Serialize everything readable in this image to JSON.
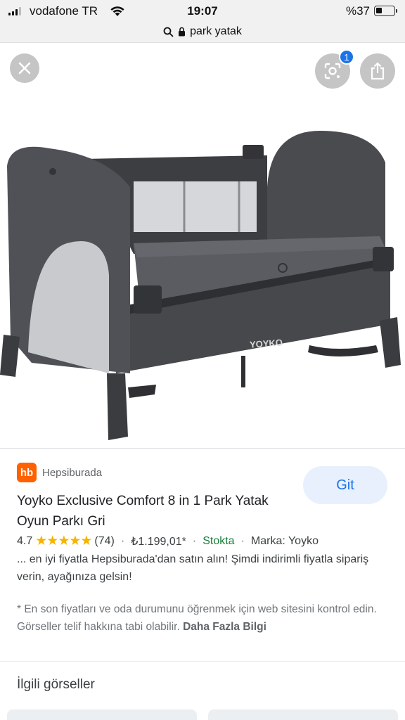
{
  "status_bar": {
    "carrier": "vodafone TR",
    "time": "19:07",
    "battery_pct": "%37"
  },
  "browser": {
    "url": "park yatak"
  },
  "viewer": {
    "close_icon": "close-icon",
    "lens_icon": "lens-icon",
    "lens_badge": "1",
    "share_icon": "share-icon",
    "product_image_text": "YOYKO"
  },
  "result": {
    "source_logo": "hb",
    "source_name": "Hepsiburada",
    "visit_label": "Git",
    "title": "Yoyko Exclusive Comfort 8 in 1 Park Yatak Oyun Parkı Gri",
    "rating": "4.7",
    "stars": "★★★★★",
    "review_count": "(74)",
    "price": "₺1.199,01*",
    "stock": "Stokta",
    "brand": "Marka: Yoyko",
    "description": "... en iyi fiyatla Hepsiburada'dan satın alın! Şimdi indirimli fiyatla sipariş verin, ayağınıza gelsin!",
    "disclaimer": "* En son fiyatları ve oda durumunu öğrenmek için web sitesini kontrol edin. Görseller telif hakkına tabi olabilir.",
    "more_info": "Daha Fazla Bilgi"
  },
  "related": {
    "title": "İlgili görseller"
  },
  "colors": {
    "accent": "#1a73e8",
    "stock_green": "#188038",
    "star": "#f6b400",
    "hb_orange": "#ff6000"
  }
}
